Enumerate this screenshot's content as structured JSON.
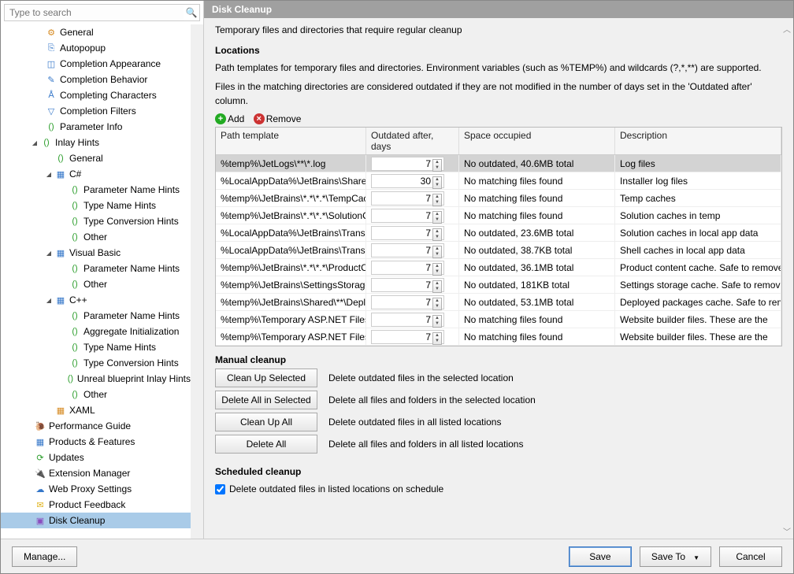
{
  "search": {
    "placeholder": "Type to search"
  },
  "tree": [
    {
      "depth": "depth-0",
      "icon": "⚙",
      "ic": "ic-orange",
      "label": "General",
      "exp": ""
    },
    {
      "depth": "depth-0",
      "icon": "⎘",
      "ic": "ic-blue",
      "label": "Autopopup",
      "exp": ""
    },
    {
      "depth": "depth-0",
      "icon": "◫",
      "ic": "ic-blue",
      "label": "Completion Appearance",
      "exp": ""
    },
    {
      "depth": "depth-0",
      "icon": "✎",
      "ic": "ic-blue",
      "label": "Completion Behavior",
      "exp": ""
    },
    {
      "depth": "depth-0",
      "icon": "Å",
      "ic": "ic-blue",
      "label": "Completing Characters",
      "exp": ""
    },
    {
      "depth": "depth-0",
      "icon": "▽",
      "ic": "ic-blue",
      "label": "Completion Filters",
      "exp": ""
    },
    {
      "depth": "depth-0",
      "icon": "()",
      "ic": "ic-green",
      "label": "Parameter Info",
      "exp": ""
    },
    {
      "depth": "depth-1",
      "icon": "()",
      "ic": "ic-green",
      "label": "Inlay Hints",
      "exp": "◢"
    },
    {
      "depth": "depth-2",
      "icon": "()",
      "ic": "ic-green",
      "label": "General",
      "exp": ""
    },
    {
      "depth": "depth-2",
      "icon": "▦",
      "ic": "ic-blue",
      "label": "C#",
      "exp": "◢"
    },
    {
      "depth": "depth-3",
      "icon": "()",
      "ic": "ic-green",
      "label": "Parameter Name Hints",
      "exp": ""
    },
    {
      "depth": "depth-3",
      "icon": "()",
      "ic": "ic-green",
      "label": "Type Name Hints",
      "exp": ""
    },
    {
      "depth": "depth-3",
      "icon": "()",
      "ic": "ic-green",
      "label": "Type Conversion Hints",
      "exp": ""
    },
    {
      "depth": "depth-3",
      "icon": "()",
      "ic": "ic-green",
      "label": "Other",
      "exp": ""
    },
    {
      "depth": "depth-2",
      "icon": "▦",
      "ic": "ic-blue",
      "label": "Visual Basic",
      "exp": "◢"
    },
    {
      "depth": "depth-3",
      "icon": "()",
      "ic": "ic-green",
      "label": "Parameter Name Hints",
      "exp": ""
    },
    {
      "depth": "depth-3",
      "icon": "()",
      "ic": "ic-green",
      "label": "Other",
      "exp": ""
    },
    {
      "depth": "depth-2",
      "icon": "▦",
      "ic": "ic-blue",
      "label": "C++",
      "exp": "◢"
    },
    {
      "depth": "depth-3",
      "icon": "()",
      "ic": "ic-green",
      "label": "Parameter Name Hints",
      "exp": ""
    },
    {
      "depth": "depth-3",
      "icon": "()",
      "ic": "ic-green",
      "label": "Aggregate Initialization",
      "exp": ""
    },
    {
      "depth": "depth-3",
      "icon": "()",
      "ic": "ic-green",
      "label": "Type Name Hints",
      "exp": ""
    },
    {
      "depth": "depth-3",
      "icon": "()",
      "ic": "ic-green",
      "label": "Type Conversion Hints",
      "exp": ""
    },
    {
      "depth": "depth-3",
      "icon": "()",
      "ic": "ic-green",
      "label": "Unreal blueprint Inlay Hints",
      "exp": ""
    },
    {
      "depth": "depth-3",
      "icon": "()",
      "ic": "ic-green",
      "label": "Other",
      "exp": ""
    },
    {
      "depth": "depth-2",
      "icon": "▦",
      "ic": "ic-orange",
      "label": "XAML",
      "exp": ""
    },
    {
      "depth": "depth-00",
      "icon": "🐌",
      "ic": "ic-green",
      "label": "Performance Guide",
      "exp": ""
    },
    {
      "depth": "depth-00",
      "icon": "▦",
      "ic": "ic-blue",
      "label": "Products & Features",
      "exp": ""
    },
    {
      "depth": "depth-00",
      "icon": "⟳",
      "ic": "ic-green",
      "label": "Updates",
      "exp": ""
    },
    {
      "depth": "depth-00",
      "icon": "🔌",
      "ic": "ic-orange",
      "label": "Extension Manager",
      "exp": ""
    },
    {
      "depth": "depth-00",
      "icon": "☁",
      "ic": "ic-blue",
      "label": "Web Proxy Settings",
      "exp": ""
    },
    {
      "depth": "depth-00",
      "icon": "✉",
      "ic": "ic-yellow",
      "label": "Product Feedback",
      "exp": ""
    },
    {
      "depth": "depth-00",
      "icon": "▣",
      "ic": "ic-purple",
      "label": "Disk Cleanup",
      "exp": "",
      "selected": true
    }
  ],
  "panel": {
    "title": "Disk Cleanup",
    "description": "Temporary files and directories that require regular cleanup",
    "locations_heading": "Locations",
    "para1": "Path templates for temporary files and directories. Environment variables (such as %TEMP%) and wildcards (?,*,**) are supported.",
    "para2": "Files in the matching directories are considered outdated if they are not modified in the number of days set in the 'Outdated after' column.",
    "add_label": "Add",
    "remove_label": "Remove",
    "columns": {
      "path": "Path template",
      "days": "Outdated after, days",
      "space": "Space occupied",
      "desc": "Description"
    },
    "rows": [
      {
        "path": "%temp%\\JetLogs\\**\\*.log",
        "days": "7",
        "space": "No outdated, 40.6MB total",
        "desc": "Log files",
        "selected": true
      },
      {
        "path": "%LocalAppData%\\JetBrains\\Shared\\",
        "days": "30",
        "space": "No matching files found",
        "desc": "Installer log files"
      },
      {
        "path": "%temp%\\JetBrains\\*.*\\*.*\\TempCache",
        "days": "7",
        "space": "No matching files found",
        "desc": "Temp caches"
      },
      {
        "path": "%temp%\\JetBrains\\*.*\\*.*\\SolutionCaches",
        "days": "7",
        "space": "No matching files found",
        "desc": "Solution caches in temp"
      },
      {
        "path": "%LocalAppData%\\JetBrains\\Transient",
        "days": "7",
        "space": "No outdated, 23.6MB total",
        "desc": "Solution caches in local app data"
      },
      {
        "path": "%LocalAppData%\\JetBrains\\Transient",
        "days": "7",
        "space": "No outdated, 38.7KB total",
        "desc": "Shell caches in local app data"
      },
      {
        "path": "%temp%\\JetBrains\\*.*\\*.*\\ProductContentCache",
        "days": "7",
        "space": "No outdated, 36.1MB total",
        "desc": "Product content cache. Safe to remove"
      },
      {
        "path": "%temp%\\JetBrains\\SettingsStorage",
        "days": "7",
        "space": "No outdated, 181KB total",
        "desc": "Settings storage cache. Safe to remove"
      },
      {
        "path": "%temp%\\JetBrains\\Shared\\**\\Deployed",
        "days": "7",
        "space": "No outdated, 53.1MB total",
        "desc": "Deployed packages cache. Safe to remove"
      },
      {
        "path": "%temp%\\Temporary ASP.NET Files\\",
        "days": "7",
        "space": "No matching files found",
        "desc": "Website builder files. These are the"
      },
      {
        "path": "%temp%\\Temporary ASP.NET Files\\",
        "days": "7",
        "space": "No matching files found",
        "desc": "Website builder files. These are the"
      }
    ],
    "manual_heading": "Manual cleanup",
    "manual": [
      {
        "btn": "Clean Up Selected",
        "txt": "Delete outdated files in the selected location"
      },
      {
        "btn": "Delete All in Selected",
        "txt": "Delete all files and folders in the selected location"
      },
      {
        "btn": "Clean Up All",
        "txt": "Delete outdated files in all listed locations"
      },
      {
        "btn": "Delete All",
        "txt": "Delete all files and folders in all listed locations"
      }
    ],
    "sched_heading": "Scheduled cleanup",
    "sched_check": "Delete outdated files in listed locations on schedule"
  },
  "footer": {
    "manage": "Manage...",
    "save": "Save",
    "saveto": "Save To",
    "cancel": "Cancel"
  }
}
